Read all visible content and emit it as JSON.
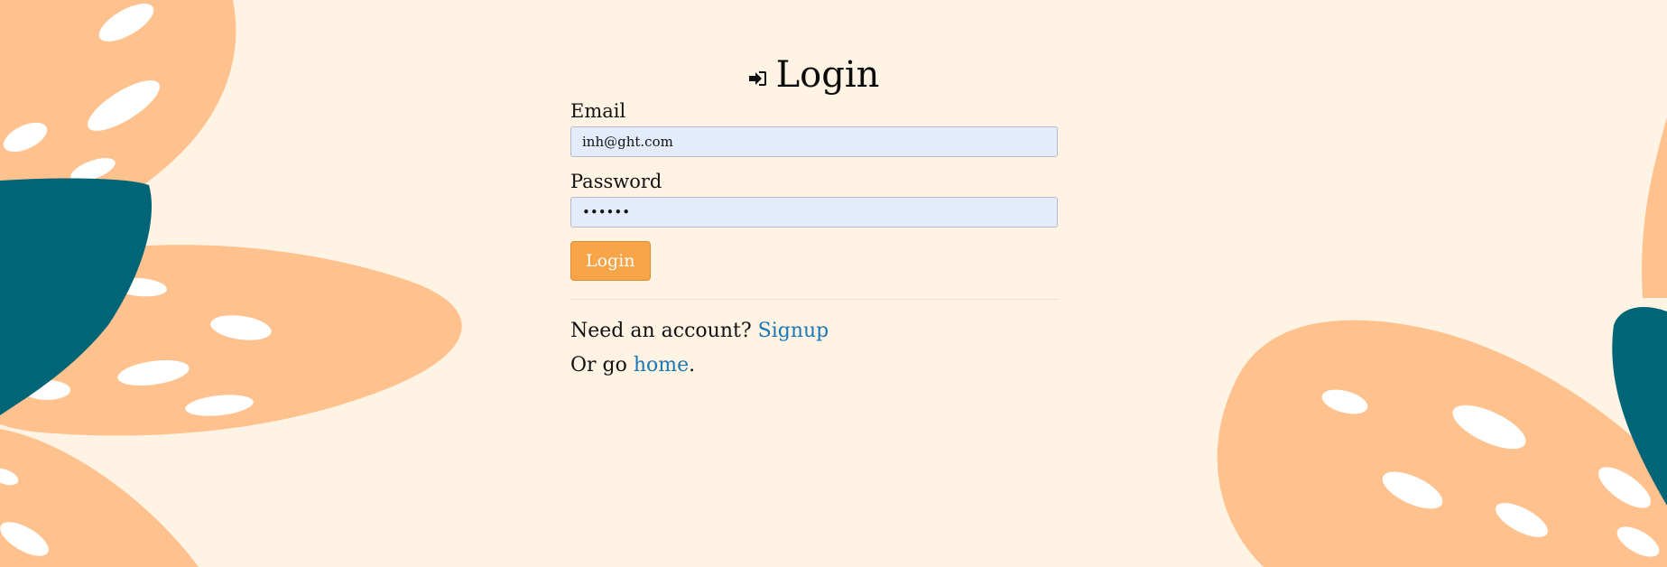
{
  "page": {
    "title": "Login",
    "title_icon": "login-icon"
  },
  "form": {
    "email_label": "Email",
    "email_value": "inh@ght.com",
    "password_label": "Password",
    "password_value": "••••••",
    "submit_label": "Login"
  },
  "footer": {
    "signup_prompt": "Need an account?",
    "signup_link": "Signup",
    "home_prefix": "Or go",
    "home_link": "home",
    "home_suffix": "."
  },
  "colors": {
    "background": "#fff3e4",
    "leaf_peach": "#ffc28e",
    "leaf_teal": "#006577",
    "button": "#f8a54a",
    "link": "#1a77b5",
    "input_bg": "#e4ecfb"
  }
}
